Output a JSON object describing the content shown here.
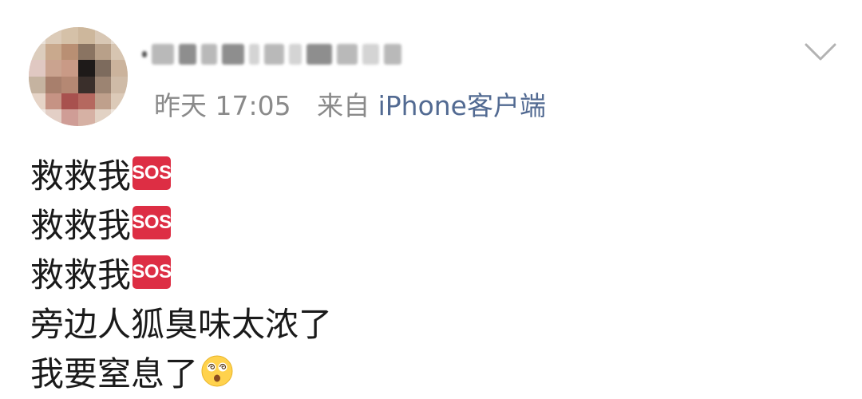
{
  "post": {
    "meta": {
      "time": "昨天 17:05",
      "source_prefix": "来自",
      "source": "iPhone客户端"
    },
    "lines": [
      {
        "text": "救救我",
        "emoji": "sos"
      },
      {
        "text": "救救我",
        "emoji": "sos"
      },
      {
        "text": "救救我",
        "emoji": "sos"
      },
      {
        "text": "旁边人狐臭味太浓了",
        "emoji": ""
      },
      {
        "text": "我要窒息了",
        "emoji": "dizzy-face"
      }
    ],
    "sos_label": "SOS",
    "icons": {
      "more": "chevron-down-icon",
      "sos": "sos-icon",
      "dizzy": "dizzy-face-icon"
    },
    "colors": {
      "text": "#1a1a1a",
      "meta": "#8a8a8a",
      "source": "#526a92",
      "sos": "#dd2e44"
    }
  }
}
